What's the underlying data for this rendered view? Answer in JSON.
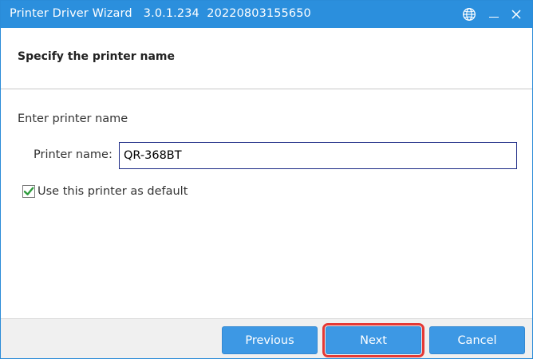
{
  "window": {
    "title": "Printer Driver Wizard",
    "version": "3.0.1.234",
    "build": "20220803155650",
    "controls": {
      "language_icon": "globe-icon",
      "minimize_icon": "minimize-icon",
      "close_icon": "close-icon",
      "close_glyph": "✕"
    }
  },
  "header": {
    "title": "Specify the printer name"
  },
  "content": {
    "section_label": "Enter printer name",
    "printer_name_label": "Printer name:",
    "printer_name_value": "QR-368BT",
    "default_checkbox": {
      "label": "Use this printer as default",
      "checked": true
    }
  },
  "footer": {
    "previous_label": "Previous",
    "next_label": "Next",
    "cancel_label": "Cancel"
  },
  "colors": {
    "titlebar": "#2b8fdd",
    "button": "#3d98e4",
    "highlight": "#e53935",
    "check": "#2e9b3c"
  }
}
